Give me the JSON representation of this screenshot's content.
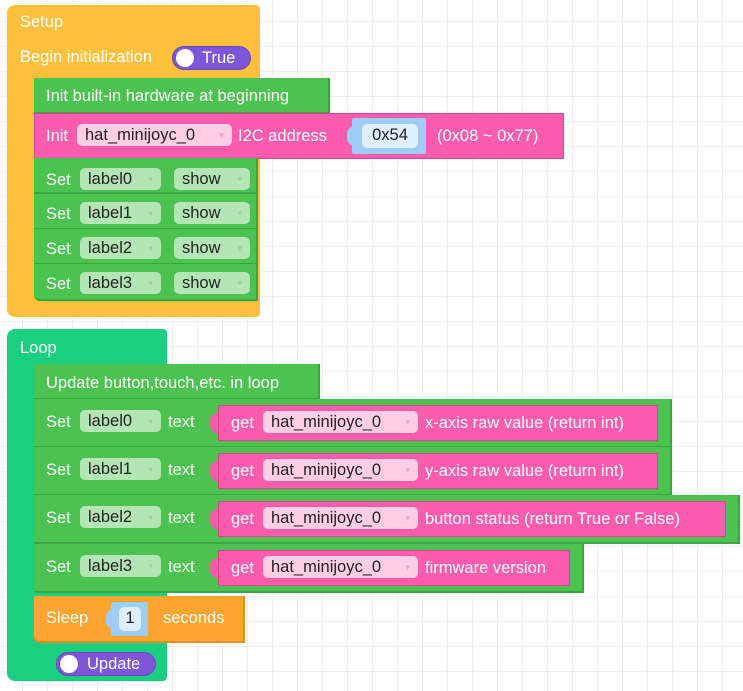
{
  "setup": {
    "title": "Setup",
    "begin_label": "Begin initialization",
    "begin_toggle": "True",
    "init_hw_label": "Init built-in hardware at beginning",
    "init_block": {
      "prefix": "Init",
      "device": "hat_minijoyc_0",
      "i2c_label": "I2C address",
      "address": "0x54",
      "range_hint": "(0x08 ~ 0x77)"
    },
    "set_rows": [
      {
        "prefix": "Set",
        "label": "label0",
        "state": "show"
      },
      {
        "prefix": "Set",
        "label": "label1",
        "state": "show"
      },
      {
        "prefix": "Set",
        "label": "label2",
        "state": "show"
      },
      {
        "prefix": "Set",
        "label": "label3",
        "state": "show"
      }
    ]
  },
  "loop": {
    "title": "Loop",
    "update_label": "Update button,touch,etc. in loop",
    "text_rows": [
      {
        "prefix": "Set",
        "label": "label0",
        "mid": "text",
        "get": "get",
        "device": "hat_minijoyc_0",
        "property": "x-axis raw value (return int)"
      },
      {
        "prefix": "Set",
        "label": "label1",
        "mid": "text",
        "get": "get",
        "device": "hat_minijoyc_0",
        "property": "y-axis raw value (return int)"
      },
      {
        "prefix": "Set",
        "label": "label2",
        "mid": "text",
        "get": "get",
        "device": "hat_minijoyc_0",
        "property": "button status (return True or False)"
      },
      {
        "prefix": "Set",
        "label": "label3",
        "mid": "text",
        "get": "get",
        "device": "hat_minijoyc_0",
        "property": "firmware version"
      }
    ],
    "sleep": {
      "prefix": "Sleep",
      "value": "1",
      "suffix": "seconds"
    },
    "update_toggle": "Update"
  },
  "icons": {
    "caret": "▾"
  },
  "colors": {
    "setup": "#fcc03c",
    "loop": "#1bcf81",
    "green_block": "#4cc350",
    "pink_block": "#fc5cae",
    "orange_block": "#fda531",
    "toggle": "#7d57d8",
    "number_socket": "#9ecdf5"
  }
}
